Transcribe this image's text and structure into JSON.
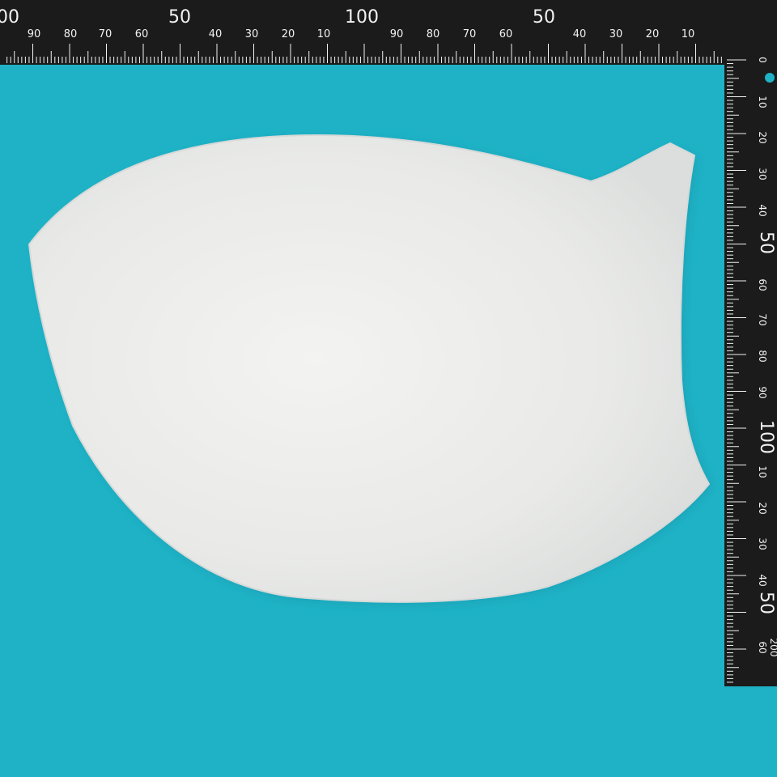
{
  "scene": {
    "background_color": "#1fb2c6",
    "object_color": "#ecedec",
    "ruler_color": "#1b1b1b",
    "ruler_mark_color": "#f2f2f2"
  },
  "top_ruler": {
    "labels": [
      "00",
      "90",
      "80",
      "70",
      "60",
      "50",
      "40",
      "30",
      "20",
      "10",
      "100",
      "90",
      "80",
      "70",
      "60",
      "50",
      "40",
      "30",
      "20",
      "10",
      "0"
    ]
  },
  "side_ruler": {
    "labels": [
      "0",
      "10",
      "20",
      "30",
      "40",
      "50",
      "60",
      "70",
      "80",
      "90",
      "100",
      "10",
      "20",
      "30",
      "40",
      "50",
      "60",
      "200"
    ]
  }
}
